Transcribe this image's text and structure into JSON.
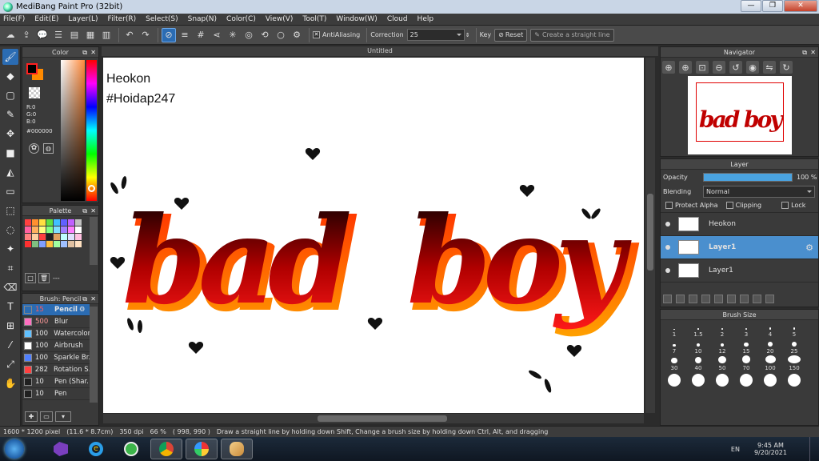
{
  "titlebar": {
    "title": "MediBang Paint Pro (32bit)",
    "min": "—",
    "max": "❐",
    "close": "✕"
  },
  "menu": [
    "File(F)",
    "Edit(E)",
    "Layer(L)",
    "Filter(R)",
    "Select(S)",
    "Snap(N)",
    "Color(C)",
    "View(V)",
    "Tool(T)",
    "Window(W)",
    "Cloud",
    "Help"
  ],
  "toolbar": {
    "antialiasing_label": "AntiAliasing",
    "antialiasing_checked": "✕",
    "correction_label": "Correction",
    "correction_value": "25",
    "key_label": "Key",
    "reset_label": "Reset",
    "straight_line_label": "Create a straight line"
  },
  "panels": {
    "color": {
      "title": "Color",
      "r": "R:0",
      "g": "G:0",
      "b": "B:0",
      "hex": "#000000"
    },
    "palette": {
      "title": "Palette",
      "swatches": [
        "#ff4040",
        "#ff9030",
        "#ffe040",
        "#60e040",
        "#40c0ff",
        "#6060ff",
        "#c060ff",
        "#c0c0c0",
        "#ff60a0",
        "#ffb060",
        "#ffff80",
        "#80ff80",
        "#80e0ff",
        "#a080ff",
        "#ff80ff",
        "#ffffff",
        "#ff8080",
        "#ffd0a0",
        "#ff4040",
        "#202020",
        "#e0a060",
        "#c0ffff",
        "#e0e0ff",
        "#ffc0e0",
        "#ff3030",
        "#80c080",
        "#80a0ff",
        "#ffc040",
        "#a0ffa0",
        "#a0c0ff",
        "#e0c0a0",
        "#ffe0c0"
      ],
      "placeholder": "---"
    },
    "brush": {
      "title": "Brush: Pencil",
      "items": [
        {
          "size": "15",
          "name": "Pencil",
          "color": "#2b6cb3"
        },
        {
          "size": "500",
          "name": "Blur",
          "color": "#ff70c0"
        },
        {
          "size": "100",
          "name": "Watercolor",
          "color": "#60c0ff"
        },
        {
          "size": "100",
          "name": "Airbrush",
          "color": "#ffffff"
        },
        {
          "size": "100",
          "name": "Sparkle Br.",
          "color": "#5080ff"
        },
        {
          "size": "282",
          "name": "Rotation S.",
          "color": "#ff4040"
        },
        {
          "size": "10",
          "name": "Pen (Shar.",
          "color": "#202020"
        },
        {
          "size": "10",
          "name": "Pen",
          "color": "#202020"
        }
      ]
    },
    "navigator": {
      "title": "Navigator"
    },
    "layer": {
      "title": "Layer",
      "opacity_label": "Opacity",
      "opacity_value": "100 %",
      "opacity_fraction": 1.0,
      "blending_label": "Blending",
      "blending_value": "Normal",
      "protect_alpha": "Protect Alpha",
      "clipping": "Clipping",
      "lock": "Lock",
      "layers": [
        {
          "name": "Heokon",
          "selected": false
        },
        {
          "name": "Layer1",
          "selected": true
        },
        {
          "name": "Layer1",
          "selected": false
        }
      ]
    },
    "brush_size": {
      "title": "Brush Size",
      "sizes": [
        "1",
        "1.5",
        "2",
        "3",
        "4",
        "5",
        "7",
        "10",
        "12",
        "15",
        "20",
        "25",
        "30",
        "40",
        "50",
        "70",
        "100",
        "150",
        "",
        "",
        "",
        "",
        "",
        ""
      ]
    }
  },
  "canvas": {
    "tab_title": "Untitled",
    "text_line1": "Heokon",
    "text_line2": "#Hoidap247",
    "art_word1": "bad",
    "art_word2": "boy"
  },
  "status": {
    "size": "1600 * 1200 pixel",
    "dims": "(11.6 * 8.7cm)",
    "dpi": "350 dpi",
    "zoom": "66 %",
    "coords": "( 998, 990 )",
    "hint": "Draw a straight line by holding down Shift, Change a brush size by holding down Ctrl, Alt, and dragging"
  },
  "taskbar": {
    "lang": "EN",
    "time": "9:45 AM",
    "date": "9/20/2021"
  }
}
